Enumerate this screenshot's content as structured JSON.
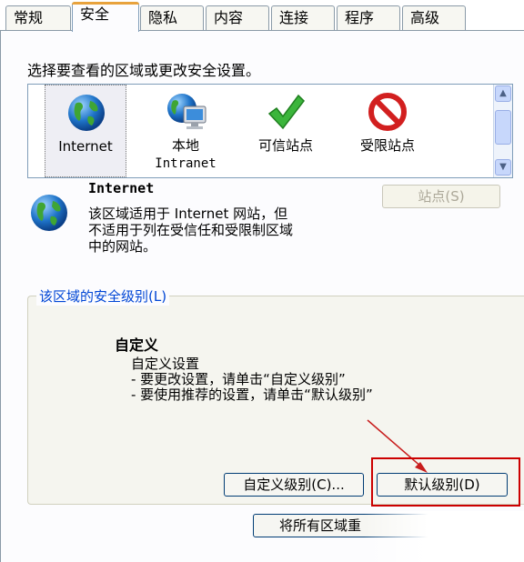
{
  "tabs": [
    {
      "label": "常规"
    },
    {
      "label": "安全"
    },
    {
      "label": "隐私"
    },
    {
      "label": "内容"
    },
    {
      "label": "连接"
    },
    {
      "label": "程序"
    },
    {
      "label": "高级"
    }
  ],
  "instruction": "选择要查看的区域或更改安全设置。",
  "zones": [
    {
      "label": "Internet",
      "icon": "globe-icon"
    },
    {
      "label": "本地",
      "sublabel": "Intranet",
      "icon": "local-intranet-icon"
    },
    {
      "label": "可信站点",
      "icon": "checkmark-icon"
    },
    {
      "label": "受限站点",
      "icon": "prohibited-icon"
    }
  ],
  "zone_detail": {
    "title": "Internet",
    "desc_line1": "该区域适用于 Internet 网站，但",
    "desc_line2": "不适用于列在受信任和受限制区域",
    "desc_line3": "中的网站。",
    "sites_button": "站点(S)"
  },
  "security_level": {
    "group_label": "该区域的安全级别(L)",
    "level_name": "自定义",
    "line1": "自定义设置",
    "line2": "- 要更改设置，请单击“自定义级别”",
    "line3": "- 要使用推荐的设置，请单击“默认级别”",
    "custom_button": "自定义级别(C)...",
    "default_button": "默认级别(D)"
  },
  "reset_button": "将所有区域重",
  "colors": {
    "accent": "#e8a23c",
    "highlight": "#cc0000",
    "link_label": "#0046d5"
  }
}
